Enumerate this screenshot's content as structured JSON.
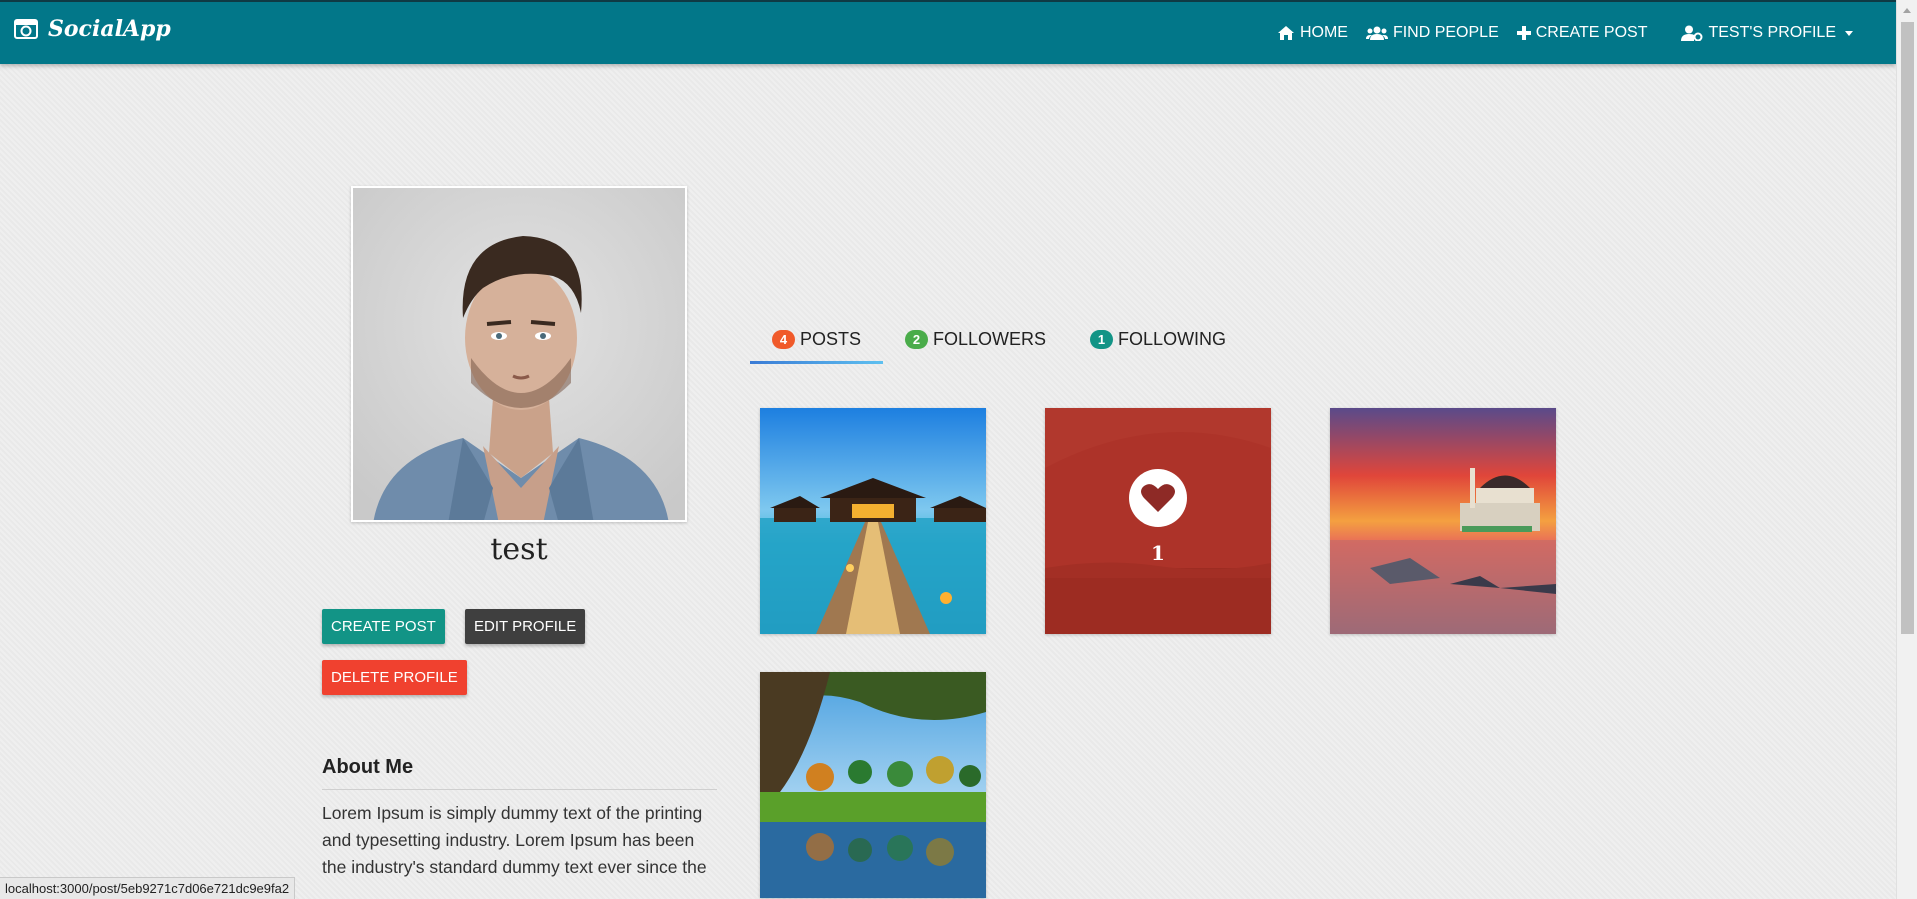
{
  "app": {
    "brand": "SocialApp"
  },
  "nav": {
    "home": "HOME",
    "find_people": "FIND PEOPLE",
    "create_post": "CREATE POST",
    "profile": "TEST'S PROFILE"
  },
  "profile": {
    "username": "test",
    "buttons": {
      "create_post": "CREATE POST",
      "edit_profile": "EDIT PROFILE",
      "delete_profile": "DELETE PROFILE"
    },
    "about": {
      "title": "About Me",
      "text": "Lorem Ipsum is simply dummy text of the printing and typesetting industry. Lorem Ipsum has been the industry's standard dummy text ever since the"
    }
  },
  "tabs": [
    {
      "label": "POSTS",
      "count": "4",
      "active": true
    },
    {
      "label": "FOLLOWERS",
      "count": "2",
      "active": false
    },
    {
      "label": "FOLLOWING",
      "count": "1",
      "active": false
    }
  ],
  "posts": [
    {
      "image": "overwater-bungalow"
    },
    {
      "image": "red-landscape",
      "likes": "1",
      "hovered": true
    },
    {
      "image": "mosque-sunset"
    },
    {
      "image": "tree-lake-reflection"
    }
  ],
  "status_url": "localhost:3000/post/5eb9271c7d06e721dc9e9fa2",
  "colors": {
    "navbar": "#027789",
    "create_btn": "#129486",
    "edit_btn": "#3f3f3f",
    "delete_btn": "#f0412f",
    "badge_posts": "#f05a2a",
    "badge_followers": "#4aac4a",
    "badge_following": "#129486"
  }
}
